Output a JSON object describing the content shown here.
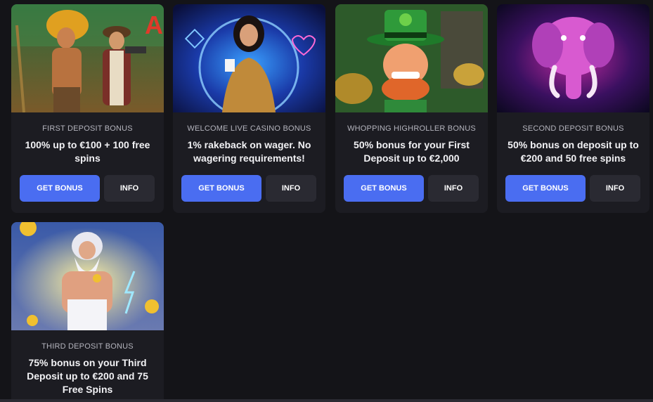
{
  "bonuses": [
    {
      "type": "FIRST DEPOSIT BONUS",
      "title": "100% up to €100 + 100 free spins",
      "primary_label": "GET BONUS",
      "secondary_label": "INFO",
      "art": "jungle-adventurers-illustration"
    },
    {
      "type": "WELCOME LIVE CASINO BONUS",
      "title": "1% rakeback on wager. No wagering requirements!",
      "primary_label": "GET BONUS",
      "secondary_label": "INFO",
      "art": "live-dealer-illustration"
    },
    {
      "type": "WHOPPING HIGHROLLER BONUS",
      "title": "50% bonus for your First Deposit up to €2,000",
      "primary_label": "GET BONUS",
      "secondary_label": "INFO",
      "art": "leprechaun-illustration"
    },
    {
      "type": "SECOND DEPOSIT BONUS",
      "title": "50% bonus on deposit up to €200 and 50 free spins",
      "primary_label": "GET BONUS",
      "secondary_label": "INFO",
      "art": "neon-elephant-illustration"
    },
    {
      "type": "THIRD DEPOSIT BONUS",
      "title": "75% bonus on your Third Deposit up to €200 and 75 Free Spins",
      "art": "zeus-illustration"
    }
  ],
  "colors": {
    "background": "#141418",
    "card": "#1c1c22",
    "primary_button": "#4a6df1",
    "secondary_button": "#2a2a32"
  }
}
